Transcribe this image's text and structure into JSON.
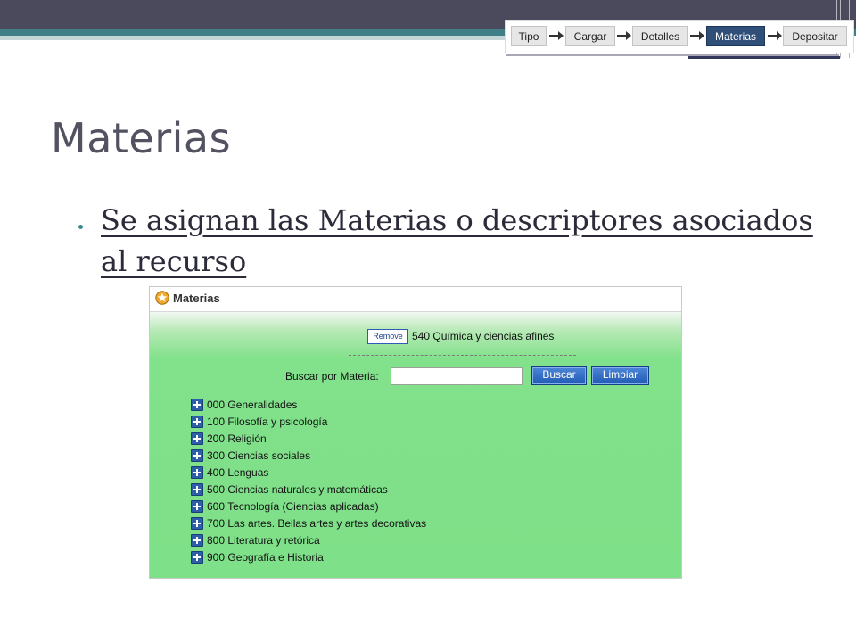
{
  "workflow": {
    "steps": [
      {
        "label": "Tipo",
        "active": false
      },
      {
        "label": "Cargar",
        "active": false
      },
      {
        "label": "Detalles",
        "active": false
      },
      {
        "label": "Materias",
        "active": true
      },
      {
        "label": "Depositar",
        "active": false
      }
    ]
  },
  "slide": {
    "title": "Materias",
    "bullet": "Se asignan las Materias o descriptores asociados al recurso"
  },
  "panel": {
    "title": "Materias",
    "remove_label": "Remove",
    "selected_subject": "540 Química y ciencias afines",
    "search_label": "Buscar por Materia:",
    "search_value": "",
    "search_button": "Buscar",
    "clear_button": "Limpiar",
    "subjects": [
      "000 Generalidades",
      "100 Filosofía y psicología",
      "200 Religión",
      "300 Ciencias sociales",
      "400 Lenguas",
      "500 Ciencias naturales y matemáticas",
      "600 Tecnología (Ciencias aplicadas)",
      "700 Las artes. Bellas artes y artes decorativas",
      "800 Literatura y retórica",
      "900 Geografía e Historia"
    ]
  },
  "colors": {
    "active_step": "#2f4e78",
    "panel_green": "#7ee088",
    "button_blue": "#1f59b2",
    "title_gray": "#525261"
  }
}
